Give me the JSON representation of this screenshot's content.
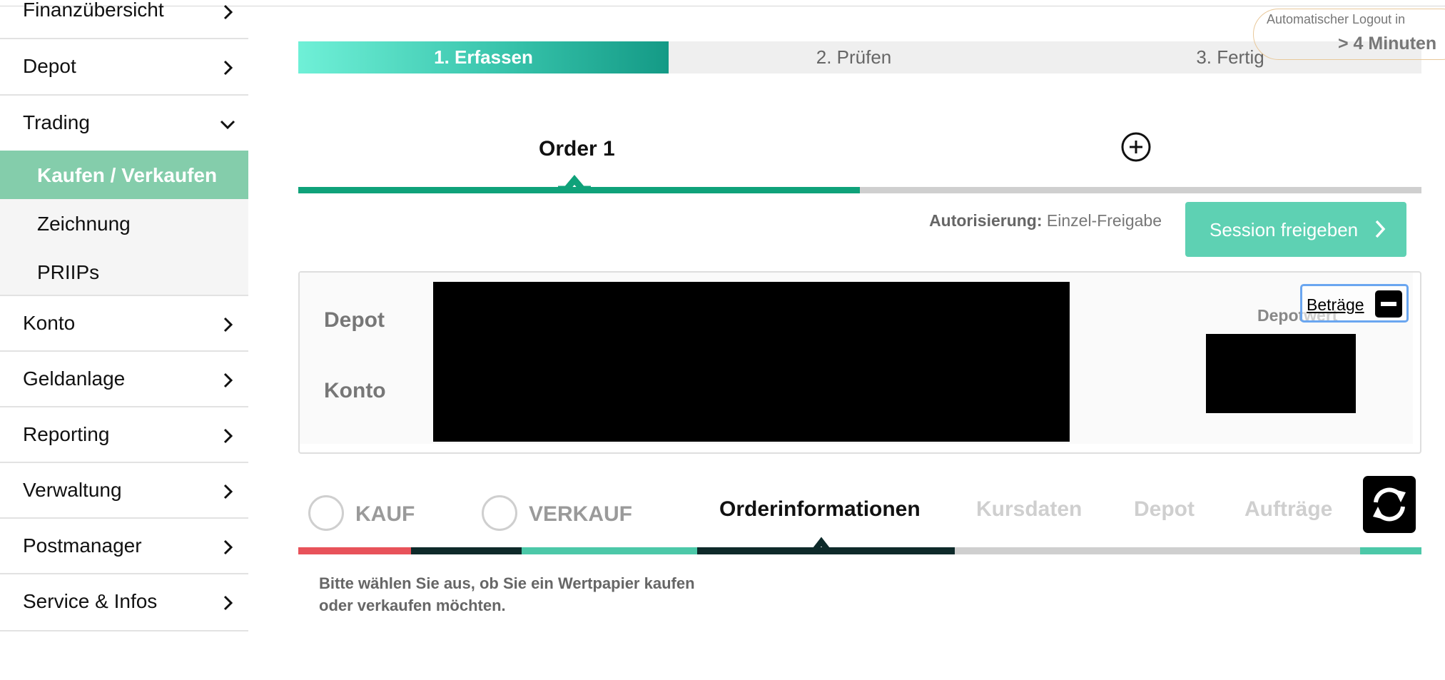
{
  "sidebar": {
    "items": [
      {
        "label": "Finanzübersicht"
      },
      {
        "label": "Depot"
      },
      {
        "label": "Trading"
      },
      {
        "label": "Konto"
      },
      {
        "label": "Geldanlage"
      },
      {
        "label": "Reporting"
      },
      {
        "label": "Verwaltung"
      },
      {
        "label": "Postmanager"
      },
      {
        "label": "Service & Infos"
      }
    ],
    "trading_subitems": [
      {
        "label": "Kaufen / Verkaufen",
        "active": true
      },
      {
        "label": "Zeichnung"
      },
      {
        "label": "PRIIPs"
      }
    ]
  },
  "steps": [
    {
      "label": "1. Erfassen",
      "active": true
    },
    {
      "label": "2. Prüfen"
    },
    {
      "label": "3. Fertig"
    }
  ],
  "logout": {
    "line1": "Automatischer  Logout  in",
    "line2": "> 4 Minuten"
  },
  "order": {
    "tab_label": "Order 1",
    "add_icon": "plus-circle-icon"
  },
  "authorization": {
    "label": "Autorisierung:",
    "value": "Einzel-Freigabe"
  },
  "session_button": {
    "label": "Session freigeben"
  },
  "depot_panel": {
    "depot_label": "Depot",
    "konto_label": "Konto",
    "depotwert_label": "Depotwert",
    "betraege_label": "Beträge"
  },
  "order_tabs": {
    "kauf": "KAUF",
    "verkauf": "VERKAUF",
    "orderinformationen": "Orderinformationen",
    "kursdaten": "Kursdaten",
    "depot": "Depot",
    "auftraege": "Aufträge"
  },
  "hint_text": "Bitte wählen Sie aus, ob Sie ein Wertpapier kaufen oder verkaufen möchten.",
  "colors": {
    "accent_green": "#0fa27a",
    "button_green": "#5ed1b3",
    "active_nav": "#84cdab",
    "kauf_red": "#e8525a",
    "dark_teal": "#0e2a2a"
  }
}
